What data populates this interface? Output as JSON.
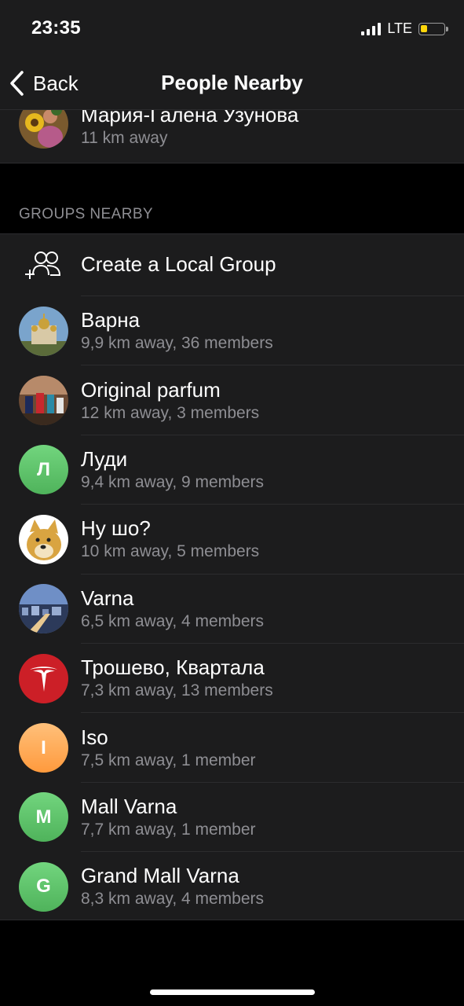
{
  "status_bar": {
    "time": "23:35",
    "network": "LTE",
    "battery_level": 0.3,
    "battery_color": "#ffd60a"
  },
  "nav": {
    "back_label": "Back",
    "title": "People Nearby"
  },
  "people": [
    {
      "name": "Мария-Галена Узунова",
      "distance": "11 km away",
      "avatar": "photo-sunflower"
    }
  ],
  "groups_header": "GROUPS NEARBY",
  "create_group": {
    "label": "Create a Local Group",
    "icon": "add-group-icon"
  },
  "groups": [
    {
      "name": "Варна",
      "subtitle": "9,9 km away, 36 members",
      "avatar": "photo-cathedral"
    },
    {
      "name": "Original parfum",
      "subtitle": "12 km away, 3 members",
      "avatar": "photo-perfume"
    },
    {
      "name": "Луди",
      "subtitle": "9,4 km away, 9 members",
      "avatar_letter": "Л",
      "color": "#5bc466"
    },
    {
      "name": "Ну шо?",
      "subtitle": "10 km away, 5 members",
      "avatar": "photo-doge"
    },
    {
      "name": "Varna",
      "subtitle": "6,5 km away, 4 members",
      "avatar": "photo-city"
    },
    {
      "name": "Трошево, Квартала",
      "subtitle": "7,3 km away, 13 members",
      "avatar": "logo-tesla"
    },
    {
      "name": "Iso",
      "subtitle": "7,5 km away, 1 member",
      "avatar_letter": "I",
      "color": "#ffa64d"
    },
    {
      "name": "Mall Varna",
      "subtitle": "7,7 km away, 1 member",
      "avatar_letter": "M",
      "color": "#5bc466"
    },
    {
      "name": "Grand Mall Varna",
      "subtitle": "8,3 km away, 4 members",
      "avatar_letter": "G",
      "color": "#5bc466"
    }
  ]
}
